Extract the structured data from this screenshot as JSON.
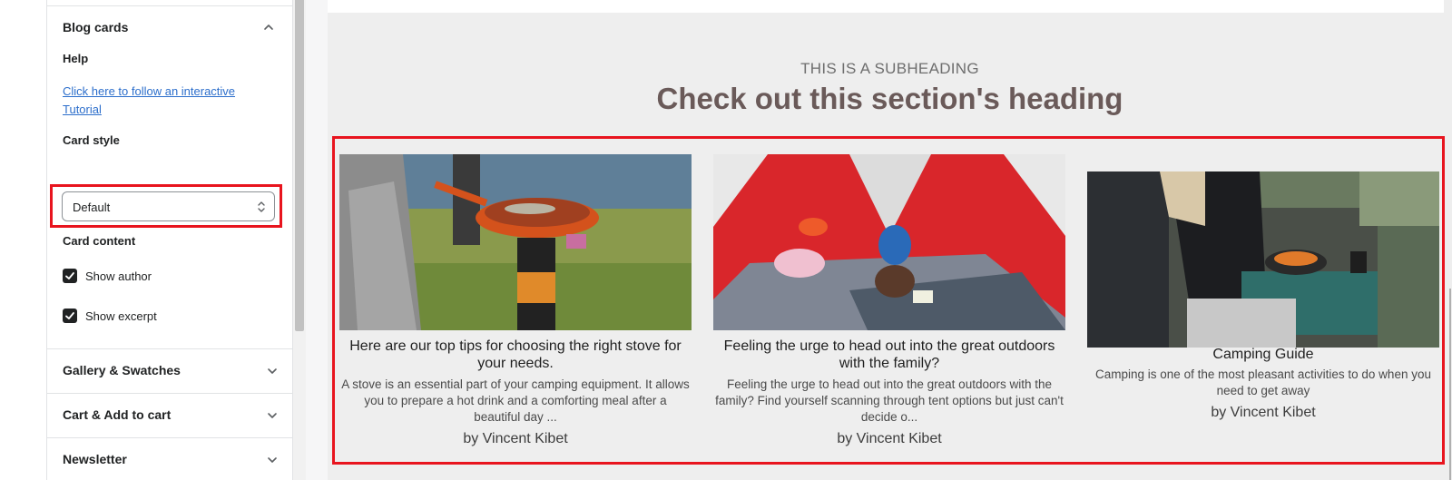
{
  "sidebar": {
    "section_title": "Blog cards",
    "help_label": "Help",
    "tutorial_link": "Click here to follow an interactive Tutorial",
    "card_style_label": "Card style",
    "card_style_value": "Default",
    "card_content_label": "Card content",
    "show_author_label": "Show author",
    "show_author_checked": true,
    "show_excerpt_label": "Show excerpt",
    "show_excerpt_checked": true,
    "collapsed_sections": [
      "Gallery & Swatches",
      "Cart & Add to cart",
      "Newsletter"
    ]
  },
  "preview": {
    "subheading": "THIS IS A SUBHEADING",
    "heading": "Check out this section's heading",
    "cards": [
      {
        "title": "Here are our top tips for choosing the right stove for your needs.",
        "excerpt": "A stove is an essential part of your camping equipment. It allows you to prepare a hot drink and a comforting meal after a beautiful day ...",
        "author": "by Vincent Kibet"
      },
      {
        "title": "Feeling the urge to head out into the great outdoors with the family?",
        "excerpt": "Feeling the urge to head out into the great outdoors with the family? Find yourself scanning through tent options but just can't decide o...",
        "author": "by Vincent Kibet"
      },
      {
        "title": "Camping Guide",
        "excerpt": "Camping is one of the most pleasant activities to do when you need to get away",
        "author": "by Vincent Kibet"
      }
    ]
  },
  "colors": {
    "highlight": "#e8141e",
    "link": "#2c6ecb",
    "heading": "#6a5a59",
    "preview_bg": "#eeeeee"
  }
}
